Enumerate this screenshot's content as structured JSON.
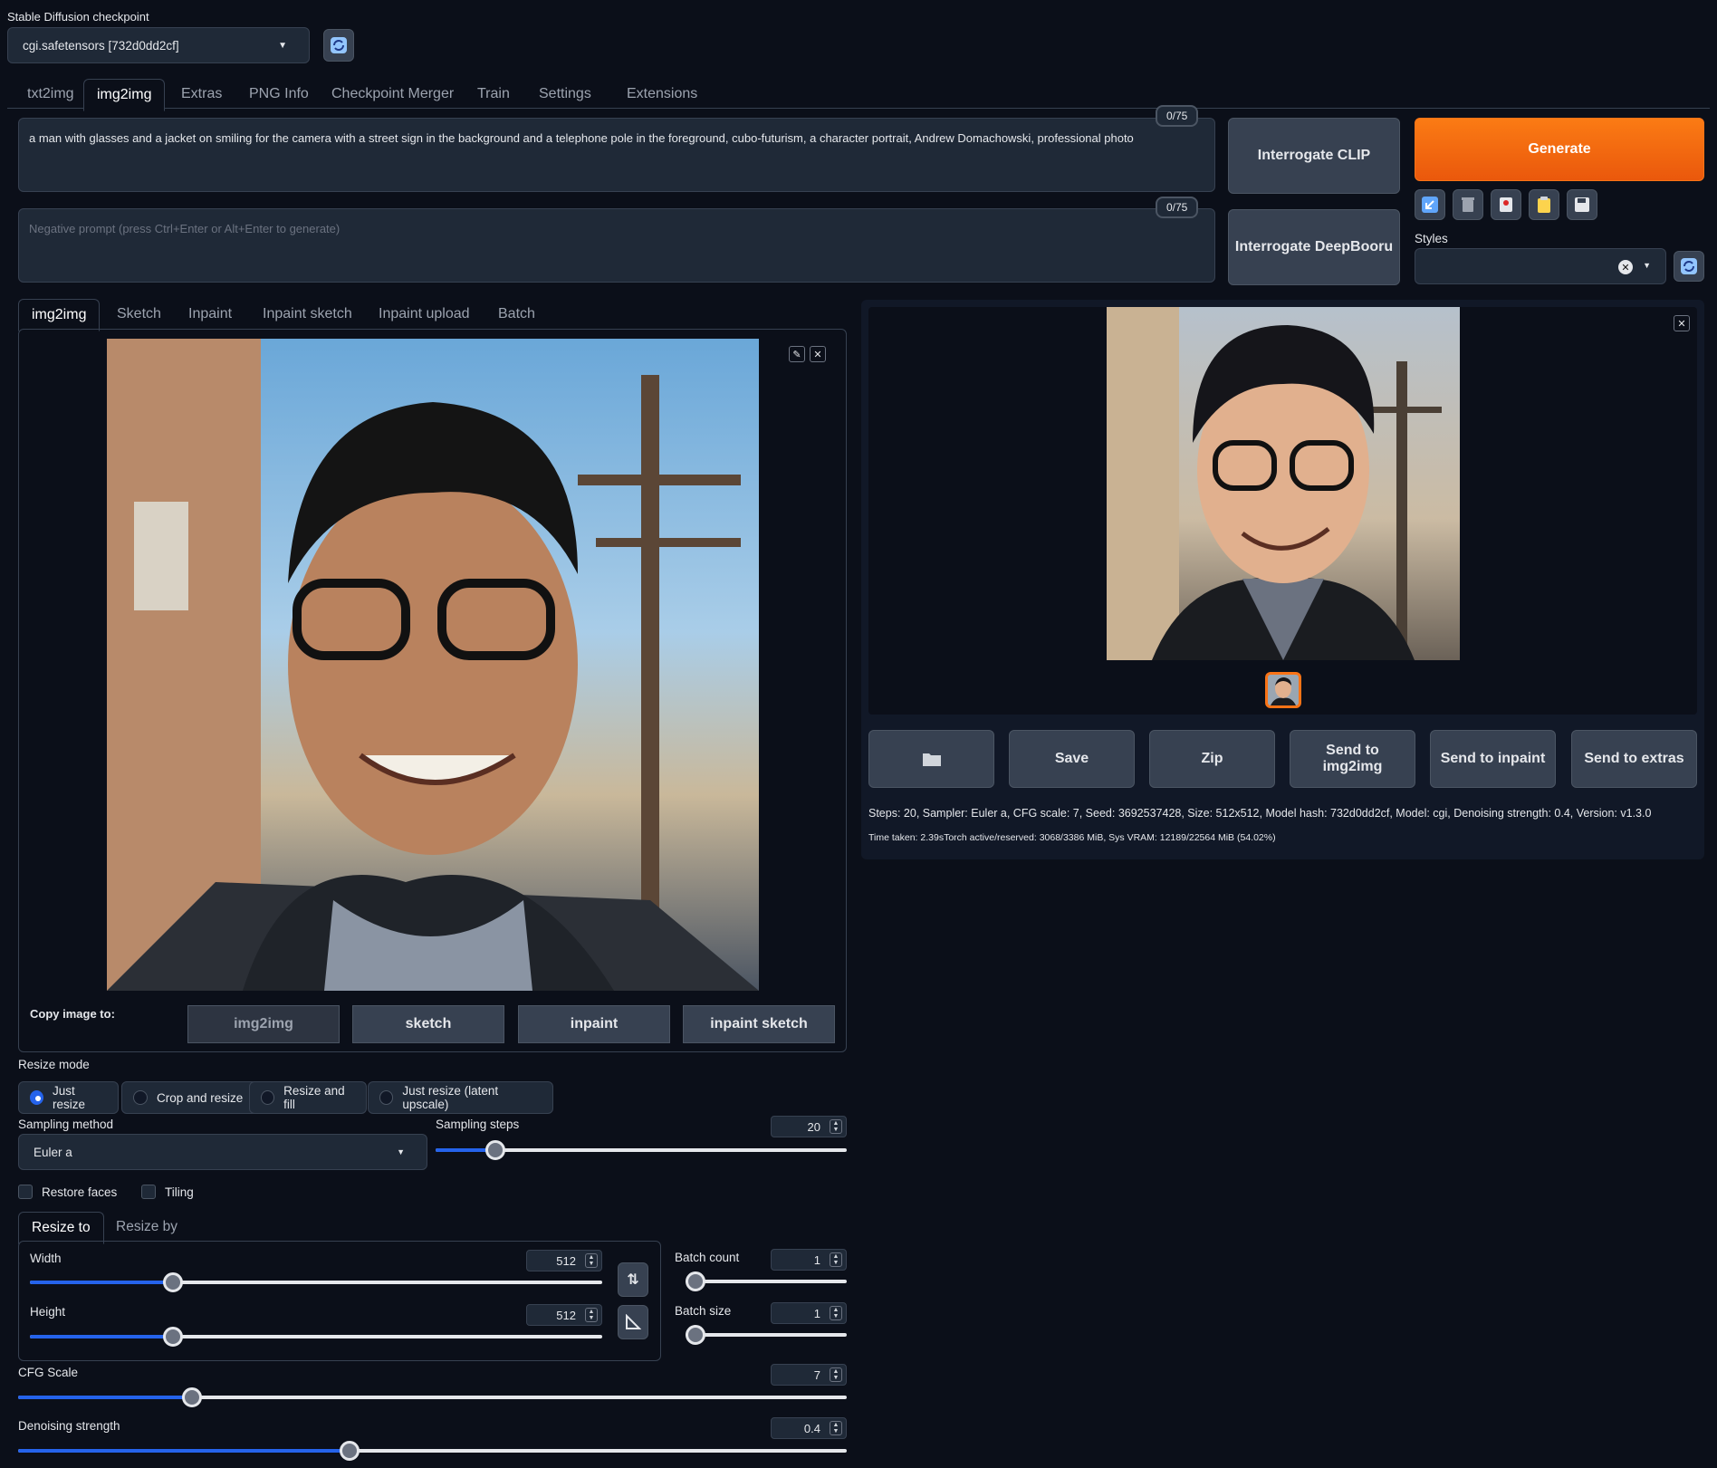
{
  "checkpoint": {
    "label": "Stable Diffusion checkpoint",
    "value": "cgi.safetensors [732d0dd2cf]"
  },
  "main_tabs": [
    "txt2img",
    "img2img",
    "Extras",
    "PNG Info",
    "Checkpoint Merger",
    "Train",
    "Settings",
    "Extensions"
  ],
  "prompt": {
    "value": "a man with glasses and a jacket on smiling for the camera with a street sign in the background and a telephone pole in the foreground, cubo-futurism, a character portrait, Andrew Domachowski, professional photo",
    "counter": "0/75"
  },
  "negative_prompt": {
    "placeholder": "Negative prompt (press Ctrl+Enter or Alt+Enter to generate)",
    "counter": "0/75"
  },
  "buttons": {
    "interrogate_clip": "Interrogate CLIP",
    "interrogate_deepbooru": "Interrogate DeepBooru",
    "generate": "Generate"
  },
  "styles": {
    "label": "Styles"
  },
  "sub_tabs": [
    "img2img",
    "Sketch",
    "Inpaint",
    "Inpaint sketch",
    "Inpaint upload",
    "Batch"
  ],
  "copy_image": {
    "label": "Copy image to:",
    "buttons": [
      "img2img",
      "sketch",
      "inpaint",
      "inpaint sketch"
    ]
  },
  "resize_mode": {
    "label": "Resize mode",
    "options": [
      "Just resize",
      "Crop and resize",
      "Resize and fill",
      "Just resize (latent upscale)"
    ],
    "selected": "Just resize"
  },
  "sampling_method": {
    "label": "Sampling method",
    "value": "Euler a"
  },
  "sampling_steps": {
    "label": "Sampling steps",
    "value": "20"
  },
  "checkboxes": {
    "restore_faces": "Restore faces",
    "tiling": "Tiling"
  },
  "resize_tabs": [
    "Resize to",
    "Resize by"
  ],
  "width": {
    "label": "Width",
    "value": "512"
  },
  "height": {
    "label": "Height",
    "value": "512"
  },
  "batch_count": {
    "label": "Batch count",
    "value": "1"
  },
  "batch_size": {
    "label": "Batch size",
    "value": "1"
  },
  "cfg_scale": {
    "label": "CFG Scale",
    "value": "7"
  },
  "denoising_strength": {
    "label": "Denoising strength",
    "value": "0.4"
  },
  "output_buttons": [
    "Save",
    "Zip",
    "Send to img2img",
    "Send to inpaint",
    "Send to extras"
  ],
  "generation_info": "Steps: 20, Sampler: Euler a, CFG scale: 7, Seed: 3692537428, Size: 512x512, Model hash: 732d0dd2cf, Model: cgi, Denoising strength: 0.4, Version: v1.3.0",
  "time_info": "Time taken: 2.39sTorch active/reserved: 3068/3386 MiB, Sys VRAM: 12189/22564 MiB (54.02%)",
  "colors": {
    "accent": "#f97316",
    "slider": "#2563eb",
    "background": "#0b0f19"
  }
}
